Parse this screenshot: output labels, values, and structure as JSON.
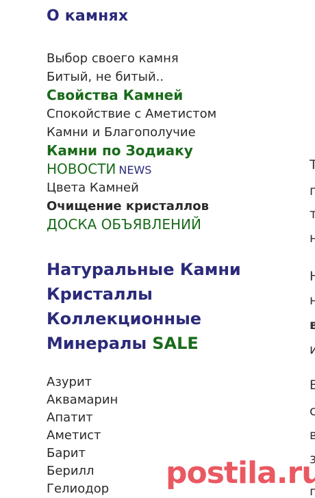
{
  "sidebar": {
    "title": "О камнях",
    "menu": [
      {
        "label": "Выбор своего камня"
      },
      {
        "label": "Битый, не битый.."
      },
      {
        "label": "Свойства Камней"
      },
      {
        "label": "Спокойствие с Аметистом"
      },
      {
        "label": "Камни и Благополучие"
      },
      {
        "label": "Камни по Зодиаку"
      },
      {
        "label": "НОВОСТИ",
        "sub": "NEWS"
      },
      {
        "label": "Цвета Камней"
      },
      {
        "label": "Очищение кристаллов"
      },
      {
        "label": "ДОСКА ОБЪЯВЛЕНИЙ"
      }
    ],
    "categories": [
      {
        "label": "Натуральные Камни"
      },
      {
        "label": "Кристаллы"
      },
      {
        "label": "Коллекционные"
      },
      {
        "label": "Минералы",
        "badge": "SALE"
      }
    ],
    "stones": [
      {
        "label": "Азурит"
      },
      {
        "label": "Аквамарин"
      },
      {
        "label": "Апатит"
      },
      {
        "label": "Аметист"
      },
      {
        "label": "Барит"
      },
      {
        "label": "Берилл"
      },
      {
        "label": "Гелиодор"
      }
    ]
  },
  "clipped_right_text": [
    {
      "text": "Т"
    },
    {
      "text": "п"
    },
    {
      "text": "т"
    },
    {
      "text": "н"
    },
    {
      "text": "Н"
    },
    {
      "text": "н"
    },
    {
      "text": "в"
    },
    {
      "text": "и"
    },
    {
      "text": "В"
    },
    {
      "text": "с"
    },
    {
      "text": "в"
    },
    {
      "text": "з"
    },
    {
      "text": "г"
    }
  ],
  "watermark": {
    "text": "postila.ru",
    "color": "#e8414c"
  }
}
